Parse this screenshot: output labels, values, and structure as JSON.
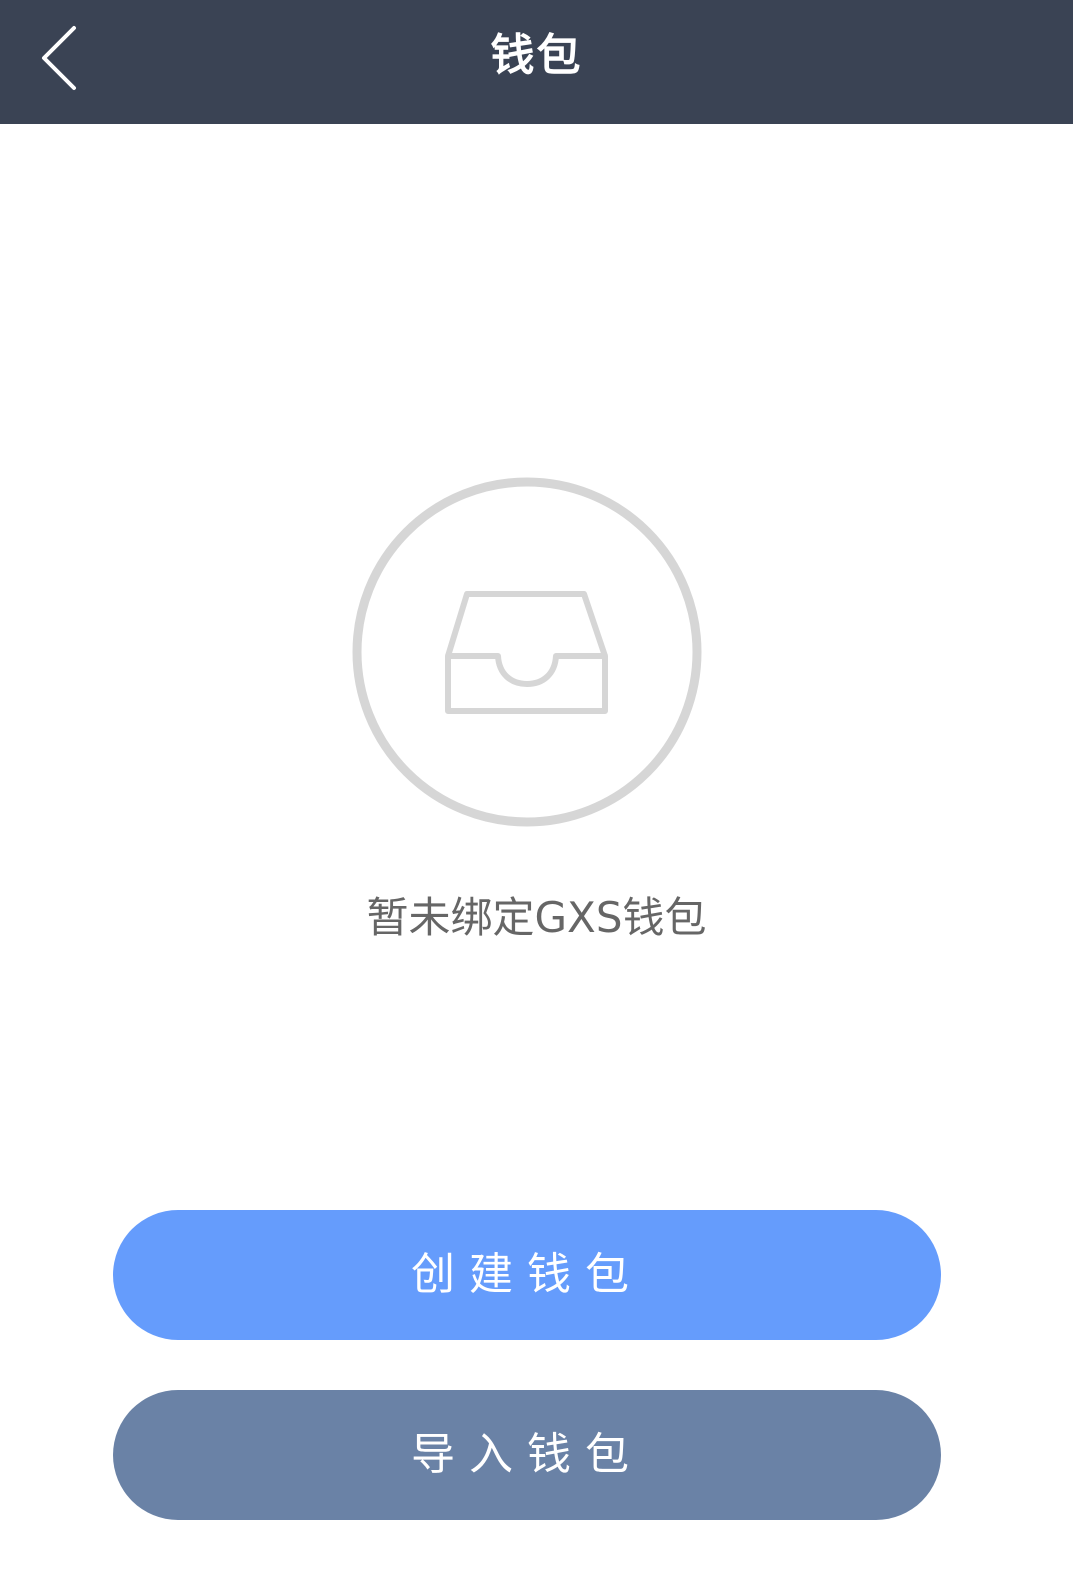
{
  "header": {
    "title": "钱包",
    "back_icon": "chevron-left-icon"
  },
  "empty_state": {
    "icon": "inbox-icon",
    "message": "暂未绑定GXS钱包"
  },
  "actions": {
    "create_label": "创建钱包",
    "import_label": "导入钱包"
  },
  "colors": {
    "header_bg": "#3a4354",
    "create_button": "#659cfc",
    "import_button": "#6a82a6",
    "icon_stroke": "#d6d6d6",
    "message_text": "#666666"
  }
}
